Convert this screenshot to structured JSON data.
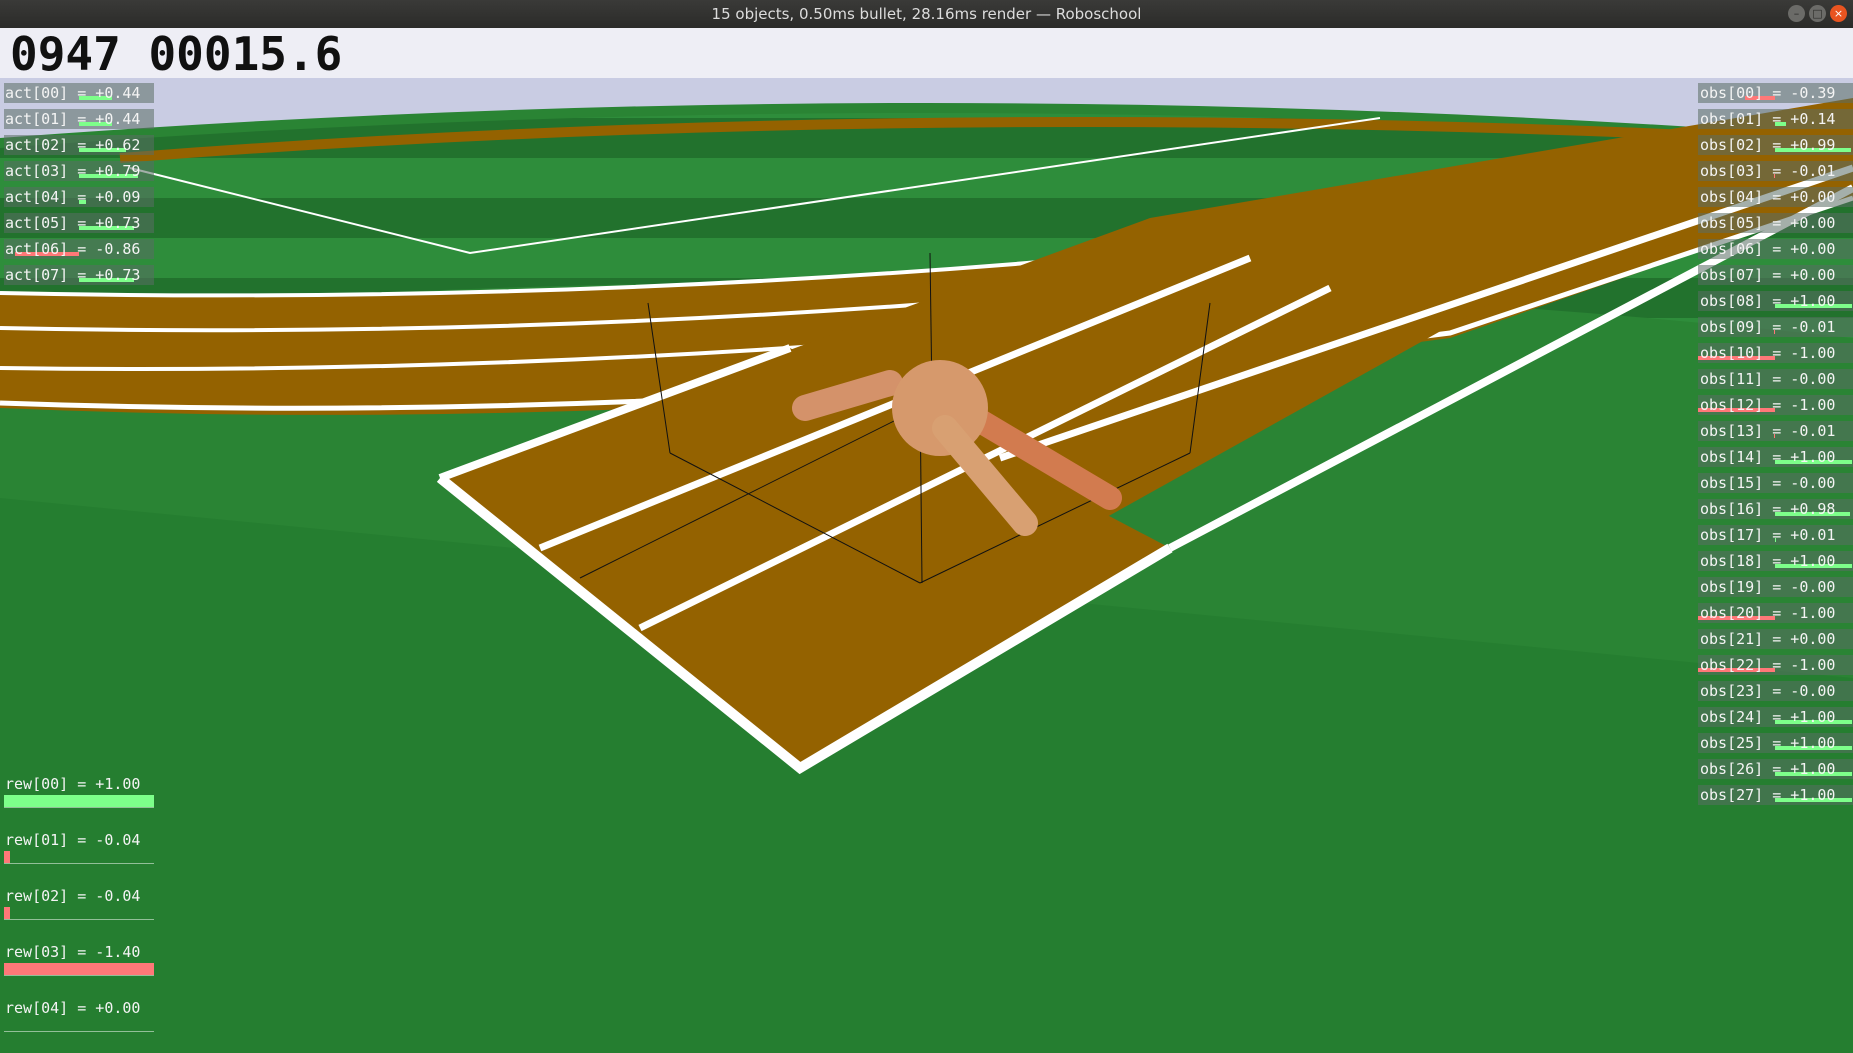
{
  "window": {
    "title": "15 objects, 0.50ms bullet, 28.16ms render — Roboschool",
    "controls": [
      "minimize-icon",
      "maximize-icon",
      "close-icon"
    ]
  },
  "hud": {
    "frame": "0947",
    "score": "00015.6"
  },
  "colors": {
    "positive": "#7dff8a",
    "negative": "#ff7878",
    "track": "#946200",
    "grass": "#2e8b3a"
  },
  "act": [
    {
      "label": "act[00] = +0.44",
      "value": 0.44
    },
    {
      "label": "act[01] = +0.44",
      "value": 0.44
    },
    {
      "label": "act[02] = +0.62",
      "value": 0.62
    },
    {
      "label": "act[03] = +0.79",
      "value": 0.79
    },
    {
      "label": "act[04] = +0.09",
      "value": 0.09
    },
    {
      "label": "act[05] = +0.73",
      "value": 0.73
    },
    {
      "label": "act[06] = -0.86",
      "value": -0.86
    },
    {
      "label": "act[07] = +0.73",
      "value": 0.73
    }
  ],
  "obs": [
    {
      "label": "obs[00] = -0.39",
      "value": -0.39
    },
    {
      "label": "obs[01] = +0.14",
      "value": 0.14
    },
    {
      "label": "obs[02] = +0.99",
      "value": 0.99
    },
    {
      "label": "obs[03] = -0.01",
      "value": -0.01
    },
    {
      "label": "obs[04] = +0.00",
      "value": 0.0
    },
    {
      "label": "obs[05] = +0.00",
      "value": 0.0
    },
    {
      "label": "obs[06] = +0.00",
      "value": 0.0
    },
    {
      "label": "obs[07] = +0.00",
      "value": 0.0
    },
    {
      "label": "obs[08] = +1.00",
      "value": 1.0
    },
    {
      "label": "obs[09] = -0.01",
      "value": -0.01
    },
    {
      "label": "obs[10] = -1.00",
      "value": -1.0
    },
    {
      "label": "obs[11] = -0.00",
      "value": 0.0
    },
    {
      "label": "obs[12] = -1.00",
      "value": -1.0
    },
    {
      "label": "obs[13] = -0.01",
      "value": -0.01
    },
    {
      "label": "obs[14] = +1.00",
      "value": 1.0
    },
    {
      "label": "obs[15] = -0.00",
      "value": 0.0
    },
    {
      "label": "obs[16] = +0.98",
      "value": 0.98
    },
    {
      "label": "obs[17] = +0.01",
      "value": 0.01
    },
    {
      "label": "obs[18] = +1.00",
      "value": 1.0
    },
    {
      "label": "obs[19] = -0.00",
      "value": 0.0
    },
    {
      "label": "obs[20] = -1.00",
      "value": -1.0
    },
    {
      "label": "obs[21] = +0.00",
      "value": 0.0
    },
    {
      "label": "obs[22] = -1.00",
      "value": -1.0
    },
    {
      "label": "obs[23] = -0.00",
      "value": 0.0
    },
    {
      "label": "obs[24] = +1.00",
      "value": 1.0
    },
    {
      "label": "obs[25] = +1.00",
      "value": 1.0
    },
    {
      "label": "obs[26] = +1.00",
      "value": 1.0
    },
    {
      "label": "obs[27] = +1.00",
      "value": 1.0
    }
  ],
  "rew": [
    {
      "label": "rew[00] = +1.00",
      "value": 1.0
    },
    {
      "label": "rew[01] = -0.04",
      "value": -0.04
    },
    {
      "label": "rew[02] = -0.04",
      "value": -0.04
    },
    {
      "label": "rew[03] = -1.40",
      "value": -1.4
    },
    {
      "label": "rew[04] = +0.00",
      "value": 0.0
    }
  ]
}
